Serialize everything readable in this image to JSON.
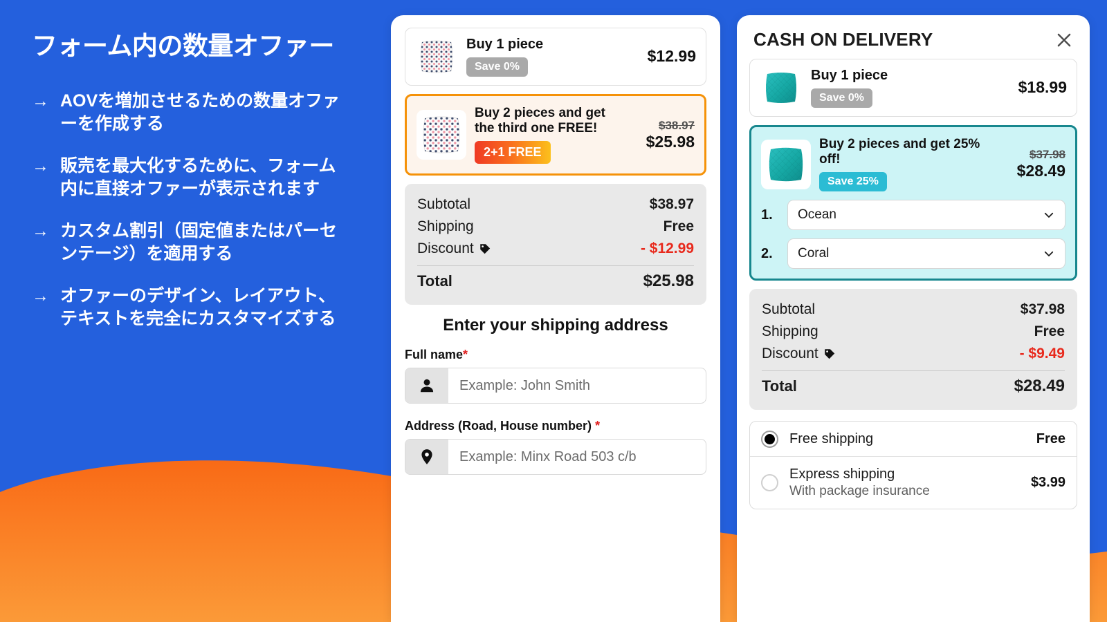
{
  "theme": {
    "background_blue": "#2460dd",
    "wave_orange_top": "#f96a16",
    "wave_orange_bottom": "#fb9534",
    "accent_orange": "#f59209",
    "accent_teal": "#17878e",
    "badge_teal": "#2bbcd4",
    "badge_grey": "#a9a9a9",
    "discount_red": "#e8291c"
  },
  "left": {
    "headline": "フォーム内の数量オファー",
    "arrow": "→",
    "bullets": [
      "AOVを増加させるための数量オファーを作成する",
      "販売を最大化するために、フォーム内に直接オファーが表示されます",
      "カスタム割引（固定値またはパーセンテージ）を適用する",
      "オファーのデザイン、レイアウト、テキストを完全にカスタマイズする"
    ]
  },
  "middle_panel": {
    "offers": [
      {
        "name": "Buy 1 piece",
        "badge": "Save 0%",
        "badge_style": "grey",
        "price_old": "",
        "price_new": "$12.99",
        "selected": false
      },
      {
        "name": "Buy 2 pieces and get the third one FREE!",
        "badge": "2+1 FREE",
        "badge_style": "fire",
        "price_old": "$38.97",
        "price_new": "$25.98",
        "selected": true
      }
    ],
    "summary": {
      "subtotal_label": "Subtotal",
      "subtotal_value": "$38.97",
      "shipping_label": "Shipping",
      "shipping_value": "Free",
      "discount_label": "Discount",
      "discount_value": "- $12.99",
      "total_label": "Total",
      "total_value": "$25.98"
    },
    "form": {
      "title": "Enter your shipping address",
      "fullname_label": "Full name",
      "fullname_required": "*",
      "fullname_placeholder": "Example: John Smith",
      "fullname_value": "",
      "address_label": "Address (Road, House number)",
      "address_required": "*",
      "address_placeholder": "Example: Minx Road 503 c/b",
      "address_value": ""
    }
  },
  "right_panel": {
    "title": "CASH ON DELIVERY",
    "close_label": "×",
    "offers": [
      {
        "name": "Buy 1 piece",
        "badge": "Save 0%",
        "badge_style": "grey",
        "price_old": "",
        "price_new": "$18.99",
        "selected": false
      },
      {
        "name": "Buy 2 pieces and get 25% off!",
        "badge": "Save 25%",
        "badge_style": "teal",
        "price_old": "$37.98",
        "price_new": "$28.49",
        "selected": true
      }
    ],
    "variants": [
      {
        "index": "1.",
        "value": "Ocean"
      },
      {
        "index": "2.",
        "value": "Coral"
      }
    ],
    "summary": {
      "subtotal_label": "Subtotal",
      "subtotal_value": "$37.98",
      "shipping_label": "Shipping",
      "shipping_value": "Free",
      "discount_label": "Discount",
      "discount_value": "- $9.49",
      "total_label": "Total",
      "total_value": "$28.49"
    },
    "shipping_options": [
      {
        "name": "Free shipping",
        "sub": "",
        "price": "Free",
        "selected": true
      },
      {
        "name": "Express shipping",
        "sub": "With package insurance",
        "price": "$3.99",
        "selected": false
      }
    ]
  }
}
